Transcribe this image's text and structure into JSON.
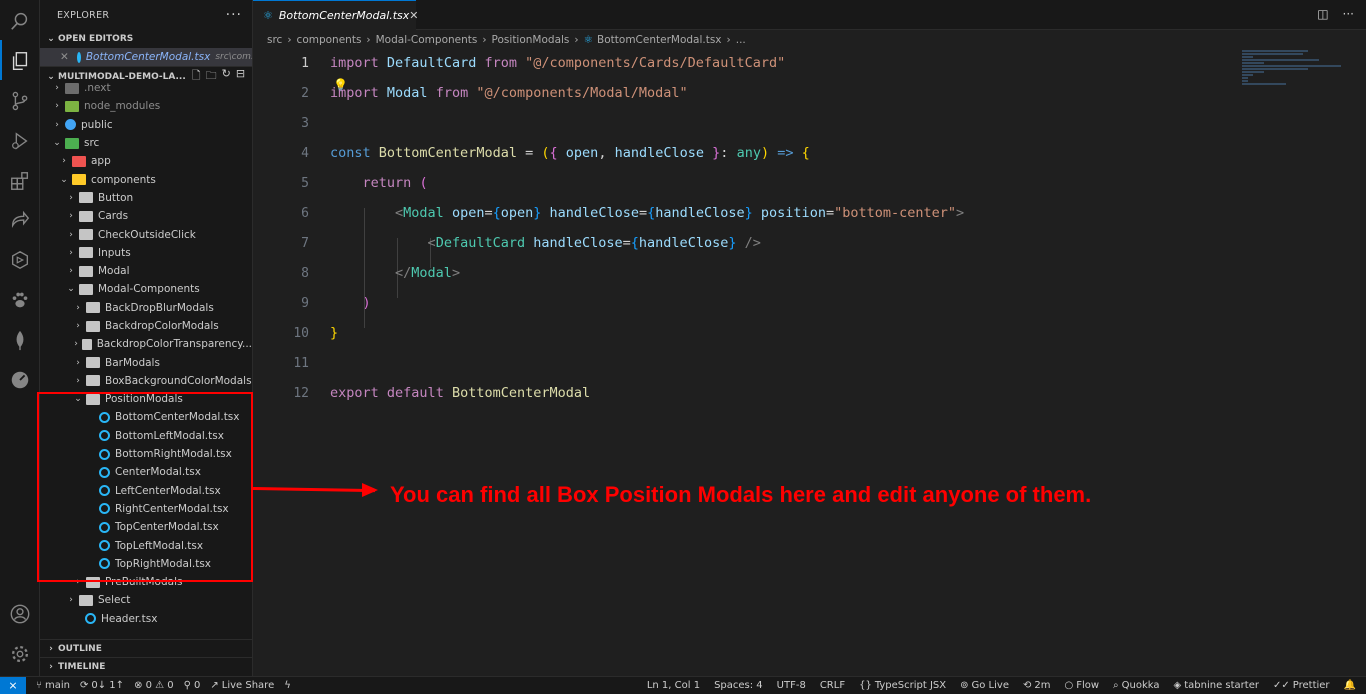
{
  "sidebar": {
    "title": "EXPLORER",
    "more": "···",
    "open_editors_label": "OPEN EDITORS",
    "open_editor": {
      "name": "BottomCenterModal.tsx",
      "path": "src\\com..."
    },
    "project_label": "MULTIMODAL-DEMO-LA...",
    "tree": [
      {
        "label": ".next",
        "indent": 1,
        "twisty": "›",
        "icon": "next",
        "dim": true
      },
      {
        "label": "node_modules",
        "indent": 1,
        "twisty": "›",
        "icon": "node",
        "dim": true
      },
      {
        "label": "public",
        "indent": 1,
        "twisty": "›",
        "icon": "public"
      },
      {
        "label": "src",
        "indent": 1,
        "twisty": "⌄",
        "icon": "src"
      },
      {
        "label": "app",
        "indent": 2,
        "twisty": "›",
        "icon": "app"
      },
      {
        "label": "components",
        "indent": 2,
        "twisty": "⌄",
        "icon": "comp"
      },
      {
        "label": "Button",
        "indent": 3,
        "twisty": "›",
        "icon": "folder"
      },
      {
        "label": "Cards",
        "indent": 3,
        "twisty": "›",
        "icon": "folder"
      },
      {
        "label": "CheckOutsideClick",
        "indent": 3,
        "twisty": "›",
        "icon": "folder"
      },
      {
        "label": "Inputs",
        "indent": 3,
        "twisty": "›",
        "icon": "folder"
      },
      {
        "label": "Modal",
        "indent": 3,
        "twisty": "›",
        "icon": "folder"
      },
      {
        "label": "Modal-Components",
        "indent": 3,
        "twisty": "⌄",
        "icon": "folder"
      },
      {
        "label": "BackDropBlurModals",
        "indent": 4,
        "twisty": "›",
        "icon": "folder"
      },
      {
        "label": "BackdropColorModals",
        "indent": 4,
        "twisty": "›",
        "icon": "folder"
      },
      {
        "label": "BackdropColorTransparency...",
        "indent": 4,
        "twisty": "›",
        "icon": "folder"
      },
      {
        "label": "BarModals",
        "indent": 4,
        "twisty": "›",
        "icon": "folder"
      },
      {
        "label": "BoxBackgroundColorModals",
        "indent": 4,
        "twisty": "›",
        "icon": "folder"
      },
      {
        "label": "PositionModals",
        "indent": 4,
        "twisty": "⌄",
        "icon": "folder"
      },
      {
        "label": "BottomCenterModal.tsx",
        "indent": 5,
        "twisty": "",
        "icon": "tsx"
      },
      {
        "label": "BottomLeftModal.tsx",
        "indent": 5,
        "twisty": "",
        "icon": "tsx"
      },
      {
        "label": "BottomRightModal.tsx",
        "indent": 5,
        "twisty": "",
        "icon": "tsx"
      },
      {
        "label": "CenterModal.tsx",
        "indent": 5,
        "twisty": "",
        "icon": "tsx"
      },
      {
        "label": "LeftCenterModal.tsx",
        "indent": 5,
        "twisty": "",
        "icon": "tsx"
      },
      {
        "label": "RightCenterModal.tsx",
        "indent": 5,
        "twisty": "",
        "icon": "tsx"
      },
      {
        "label": "TopCenterModal.tsx",
        "indent": 5,
        "twisty": "",
        "icon": "tsx"
      },
      {
        "label": "TopLeftModal.tsx",
        "indent": 5,
        "twisty": "",
        "icon": "tsx"
      },
      {
        "label": "TopRightModal.tsx",
        "indent": 5,
        "twisty": "",
        "icon": "tsx"
      },
      {
        "label": "PreBuiltModals",
        "indent": 4,
        "twisty": "›",
        "icon": "folder"
      },
      {
        "label": "Select",
        "indent": 3,
        "twisty": "›",
        "icon": "folder"
      },
      {
        "label": "Header.tsx",
        "indent": 3,
        "twisty": "",
        "icon": "tsx"
      }
    ],
    "outline_label": "OUTLINE",
    "timeline_label": "TIMELINE"
  },
  "tab": {
    "label": "BottomCenterModal.tsx",
    "close": "✕"
  },
  "breadcrumbs": [
    "src",
    "components",
    "Modal-Components",
    "PositionModals",
    "BottomCenterModal.tsx",
    "..."
  ],
  "code_lines": [
    "1",
    "2",
    "3",
    "4",
    "5",
    "6",
    "7",
    "8",
    "9",
    "10",
    "11",
    "12"
  ],
  "annotation": "You can find all Box Position Modals here and edit anyone of them.",
  "status": {
    "branch": "main",
    "sync": "0↓ 1↑",
    "problems": "⊗ 0 ⚠ 0",
    "ports": "0",
    "live_share": "Live Share",
    "position": "Ln 1, Col 1",
    "spaces": "Spaces: 4",
    "encoding": "UTF-8",
    "eol": "CRLF",
    "language": "TypeScript JSX",
    "go_live": "Go Live",
    "time": "2m",
    "flow": "Flow",
    "quokka": "Quokka",
    "tabnine": "tabnine starter",
    "prettier": "Prettier"
  }
}
